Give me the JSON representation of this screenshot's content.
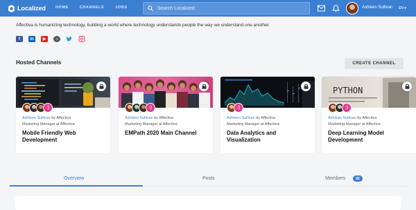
{
  "app": {
    "name": "Localized"
  },
  "nav": {
    "links": [
      "HOME",
      "CHANNELS",
      "JOBS"
    ],
    "search_placeholder": "Search Localized",
    "user_name": "Ashleen Sullivan",
    "lang": "EN"
  },
  "org": {
    "description": "Affectiva is humanizing technology, building a world where technology understands people the way we understand one another.",
    "socials": [
      "facebook-icon",
      "linkedin-icon",
      "youtube-icon",
      "website-icon",
      "twitter-icon",
      "instagram-icon"
    ]
  },
  "hosted": {
    "title": "Hosted Channels",
    "create_label": "CREATE CHANNEL",
    "cards": [
      {
        "owner": "Ashleen Sullivan",
        "by": "by Affectiva",
        "role": "Marketing Manager at Affectiva",
        "title": "Mobile Friendly Web Development"
      },
      {
        "owner": "Ashleen Sullivan",
        "by": "by Affectiva",
        "role": "Marketing Manager at Affectiva",
        "title": "EMPath 2020 Main Channel"
      },
      {
        "owner": "Ashleen Sullivan",
        "by": "by Affectiva",
        "role": "Marketing Manager at Affectiva",
        "title": "Data Analytics and Visualization"
      },
      {
        "owner": "Ashleen Sullivan",
        "by": "by Affectiva",
        "role": "Marketing Manager at Affectiva",
        "title": "Deep Learning Model Development"
      }
    ]
  },
  "tabs": {
    "items": [
      "Overview",
      "Posts",
      "Members"
    ],
    "members_count": "82",
    "active": "Overview"
  },
  "colors": {
    "brand": "#3b7fd1",
    "channel_badge": "#e33b8f"
  }
}
